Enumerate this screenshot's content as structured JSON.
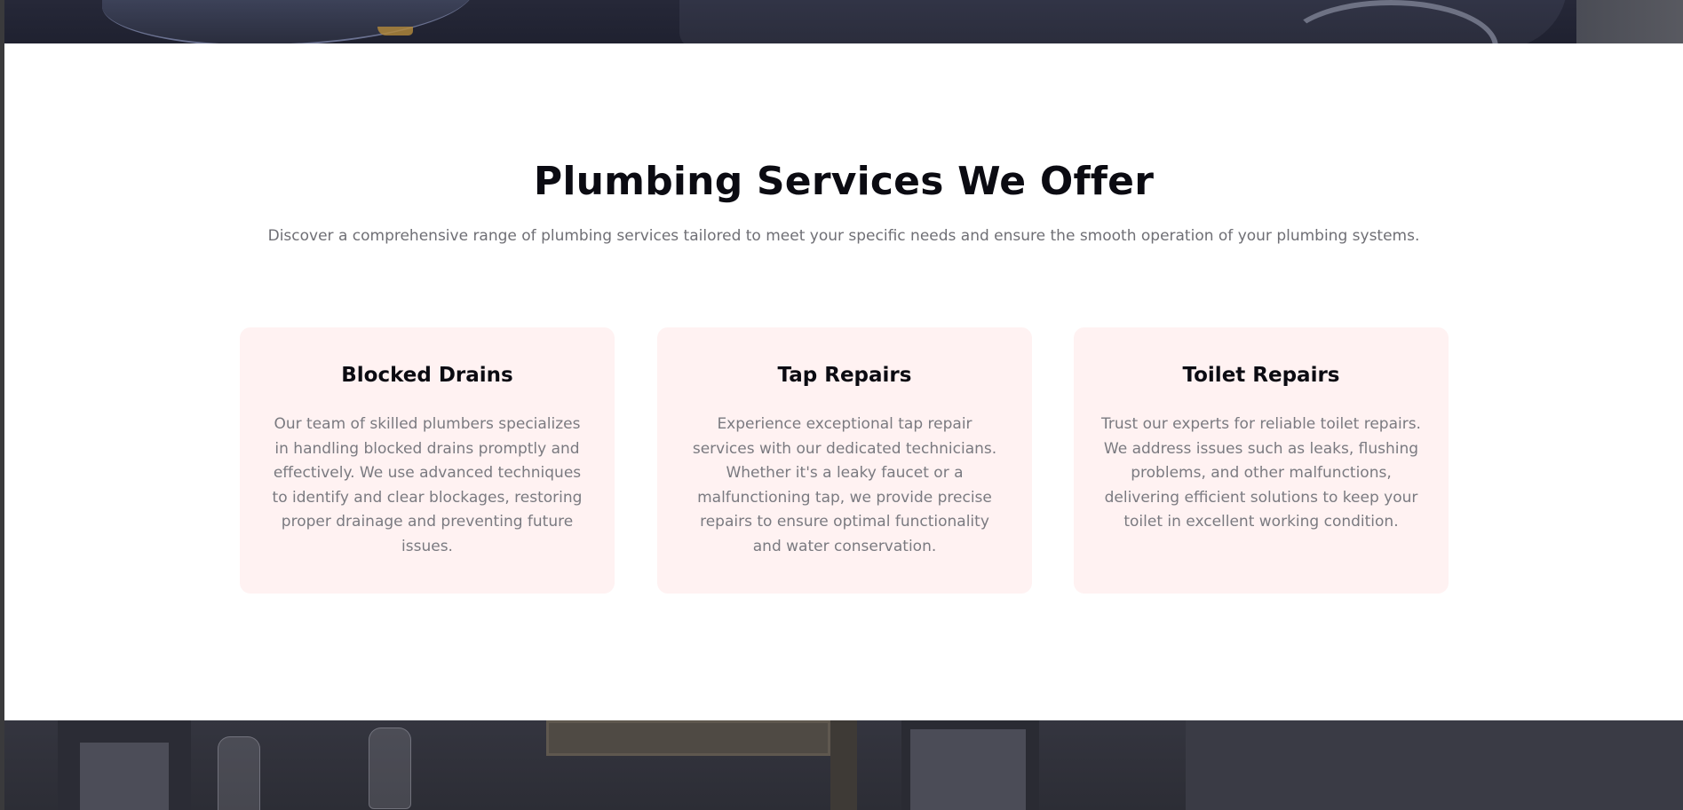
{
  "services": {
    "title": "Plumbing Services We Offer",
    "subtitle": "Discover a comprehensive range of plumbing services tailored to meet your specific needs and ensure the smooth operation of your plumbing systems.",
    "cards": [
      {
        "title": "Blocked Drains",
        "text": "Our team of skilled plumbers specializes in handling blocked drains promptly and effectively. We use advanced techniques to identify and clear blockages, restoring proper drainage and preventing future issues."
      },
      {
        "title": "Tap Repairs",
        "text": "Experience exceptional tap repair services with our dedicated technicians. Whether it's a leaky faucet or a malfunctioning tap, we provide precise repairs to ensure optimal functionality and water conservation."
      },
      {
        "title": "Toilet Repairs",
        "text": "Trust our experts for reliable toilet repairs. We address issues such as leaks, flushing problems, and other malfunctions, delivering efficient solutions to keep your toilet in excellent working condition."
      }
    ]
  },
  "colors": {
    "card_background": "#fff2f2",
    "heading": "#0b0b12",
    "body_text": "#7a7a80"
  }
}
